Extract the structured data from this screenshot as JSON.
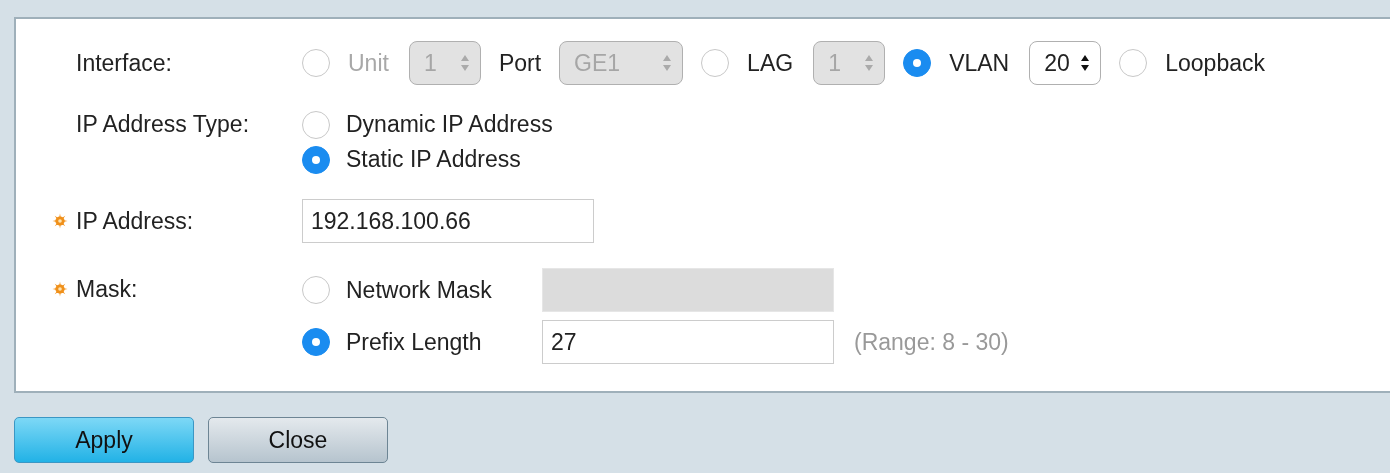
{
  "interface": {
    "label": "Interface:",
    "options": [
      {
        "kind": "radio",
        "label": "Unit",
        "selected": false,
        "disabled": true
      },
      {
        "kind": "select",
        "value": "1",
        "disabled": true
      },
      {
        "kind": "label",
        "label": "Port"
      },
      {
        "kind": "select",
        "value": "GE1",
        "disabled": true
      },
      {
        "kind": "radio",
        "label": "LAG",
        "selected": false,
        "disabled": false
      },
      {
        "kind": "select",
        "value": "1",
        "disabled": true
      },
      {
        "kind": "radio",
        "label": "VLAN",
        "selected": true,
        "disabled": false
      },
      {
        "kind": "select",
        "value": "20",
        "disabled": false
      },
      {
        "kind": "radio",
        "label": "Loopback",
        "selected": false,
        "disabled": false
      }
    ]
  },
  "ip_address_type": {
    "label": "IP Address Type:",
    "options": [
      {
        "label": "Dynamic IP Address",
        "selected": false
      },
      {
        "label": "Static IP Address",
        "selected": true
      }
    ]
  },
  "ip_address": {
    "label": "IP Address:",
    "required": true,
    "value": "192.168.100.66"
  },
  "mask": {
    "label": "Mask:",
    "required": true,
    "options": [
      {
        "label": "Network Mask",
        "selected": false,
        "field": {
          "disabled": true
        }
      },
      {
        "label": "Prefix Length",
        "selected": true,
        "field": {
          "value": "27",
          "disabled": false
        },
        "hint": "(Range: 8 - 30)"
      }
    ]
  },
  "buttons": [
    {
      "label": "Apply",
      "kind": "primary"
    },
    {
      "label": "Close",
      "kind": "secondary"
    }
  ]
}
